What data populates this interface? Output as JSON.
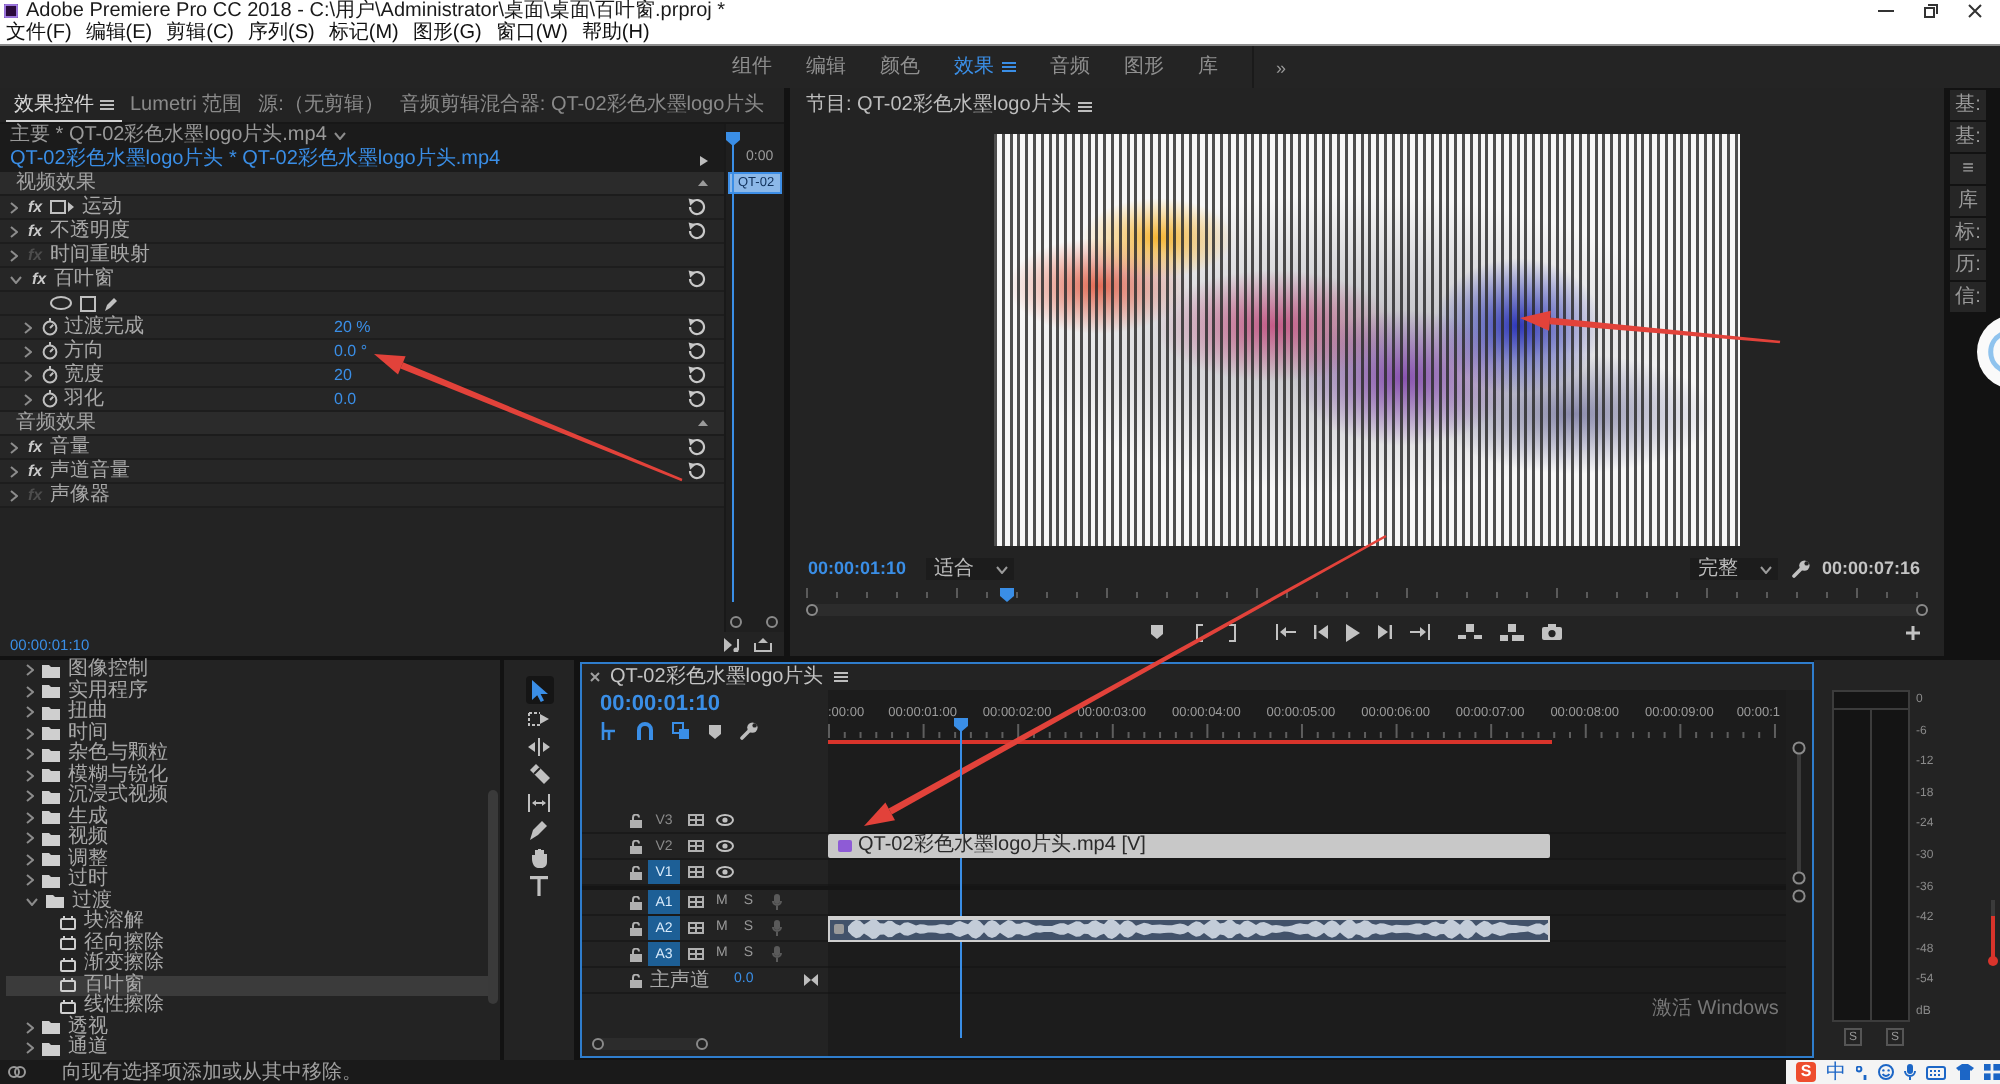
{
  "window": {
    "title": "Adobe Premiere Pro CC 2018 - C:\\用户\\Administrator\\桌面\\桌面\\百叶窗.prproj *"
  },
  "menu": [
    "文件(F)",
    "编辑(E)",
    "剪辑(C)",
    "序列(S)",
    "标记(M)",
    "图形(G)",
    "窗口(W)",
    "帮助(H)"
  ],
  "workspaces": {
    "items": [
      {
        "label": "组件",
        "selected": false
      },
      {
        "label": "编辑",
        "selected": false
      },
      {
        "label": "颜色",
        "selected": false
      },
      {
        "label": "效果",
        "selected": true
      },
      {
        "label": "音频",
        "selected": false
      },
      {
        "label": "图形",
        "selected": false
      },
      {
        "label": "库",
        "selected": false
      }
    ],
    "overflow": "»"
  },
  "effect_controls": {
    "tabs": [
      {
        "label": "效果控件",
        "selected": true
      },
      {
        "label": "Lumetri 范围",
        "selected": false
      },
      {
        "label": "源:（无剪辑）",
        "selected": false
      },
      {
        "label": "音频剪辑混合器: QT-02彩色水墨logo片头",
        "selected": false
      }
    ],
    "master_clip": "主要 * QT-02彩色水墨logo片头.mp4",
    "sequence_clip": "QT-02彩色水墨logo片头 * QT-02彩色水墨logo片头.mp4",
    "mini_timeline": {
      "time": "0:00",
      "clip": "QT-02"
    },
    "sections": [
      {
        "title": "视频效果",
        "expanded": true,
        "effects": [
          {
            "name": "运动",
            "kind": "motion",
            "badge": "fx",
            "enabled": true,
            "expanded": false,
            "resettable": true
          },
          {
            "name": "不透明度",
            "kind": "standard",
            "badge": "fx",
            "enabled": true,
            "expanded": false,
            "resettable": true
          },
          {
            "name": "时间重映射",
            "kind": "standard",
            "badge": "fx",
            "enabled": false,
            "expanded": false,
            "resettable": false
          },
          {
            "name": "百叶窗",
            "kind": "masked",
            "badge": "fx",
            "enabled": true,
            "expanded": true,
            "resettable": true,
            "parameters": [
              {
                "name": "过渡完成",
                "value": "20 %",
                "expanded": false
              },
              {
                "name": "方向",
                "value": "0.0 °",
                "expanded": false
              },
              {
                "name": "宽度",
                "value": "20",
                "expanded": false
              },
              {
                "name": "羽化",
                "value": "0.0",
                "expanded": false
              }
            ]
          }
        ]
      },
      {
        "title": "音频效果",
        "expanded": true,
        "effects": [
          {
            "name": "音量",
            "kind": "standard",
            "badge": "fx",
            "enabled": true,
            "expanded": false,
            "resettable": true
          },
          {
            "name": "声道音量",
            "kind": "standard",
            "badge": "fx",
            "enabled": true,
            "expanded": false,
            "resettable": true
          },
          {
            "name": "声像器",
            "kind": "standard",
            "badge": "fx",
            "enabled": false,
            "expanded": false,
            "resettable": false
          }
        ]
      }
    ],
    "current_time": "00:00:01:10"
  },
  "program_monitor": {
    "title": "节目: QT-02彩色水墨logo片头",
    "current_time": "00:00:01:10",
    "fit": "适合",
    "quality": "完整",
    "duration": "00:00:07:16",
    "scrubber": {
      "level": 0.18
    }
  },
  "side_panels": [
    "基:",
    "基:",
    "≡",
    "库",
    "标:",
    "历:",
    "信:"
  ],
  "effects_browser": {
    "items": [
      {
        "name": "图像控制",
        "kind": "folder",
        "expanded": false,
        "selected": false
      },
      {
        "name": "实用程序",
        "kind": "folder",
        "expanded": false,
        "selected": false
      },
      {
        "name": "扭曲",
        "kind": "folder",
        "expanded": false,
        "selected": false
      },
      {
        "name": "时间",
        "kind": "folder",
        "expanded": false,
        "selected": false
      },
      {
        "name": "杂色与颗粒",
        "kind": "folder",
        "expanded": false,
        "selected": false
      },
      {
        "name": "模糊与锐化",
        "kind": "folder",
        "expanded": false,
        "selected": false
      },
      {
        "name": "沉浸式视频",
        "kind": "folder",
        "expanded": false,
        "selected": false
      },
      {
        "name": "生成",
        "kind": "folder",
        "expanded": false,
        "selected": false
      },
      {
        "name": "视频",
        "kind": "folder",
        "expanded": false,
        "selected": false
      },
      {
        "name": "调整",
        "kind": "folder",
        "expanded": false,
        "selected": false
      },
      {
        "name": "过时",
        "kind": "folder",
        "expanded": false,
        "selected": false
      },
      {
        "name": "过渡",
        "kind": "folder",
        "expanded": true,
        "selected": false,
        "children": [
          {
            "name": "块溶解",
            "kind": "effect",
            "selected": false
          },
          {
            "name": "径向擦除",
            "kind": "effect",
            "selected": false
          },
          {
            "name": "渐变擦除",
            "kind": "effect",
            "selected": false
          },
          {
            "name": "百叶窗",
            "kind": "effect",
            "selected": true
          },
          {
            "name": "线性擦除",
            "kind": "effect",
            "selected": false
          }
        ]
      },
      {
        "name": "透视",
        "kind": "folder",
        "expanded": false,
        "selected": false
      },
      {
        "name": "通道",
        "kind": "folder",
        "expanded": false,
        "selected": false
      }
    ]
  },
  "tools": [
    {
      "kind": "selection",
      "selected": true
    },
    {
      "kind": "track_select",
      "selected": false
    },
    {
      "kind": "ripple_edit",
      "selected": false
    },
    {
      "kind": "razor",
      "selected": false
    },
    {
      "kind": "slip",
      "selected": false
    },
    {
      "kind": "pen",
      "selected": false
    },
    {
      "kind": "hand",
      "selected": false
    },
    {
      "kind": "type",
      "selected": false
    }
  ],
  "timeline": {
    "title": "QT-02彩色水墨logo片头",
    "current_time": "00:00:01:10",
    "ruler": [
      ":00:00",
      "00:00:01:00",
      "00:00:02:00",
      "00:00:03:00",
      "00:00:04:00",
      "00:00:05:00",
      "00:00:06:00",
      "00:00:07:00",
      "00:00:08:00",
      "00:00:09:00",
      "00:00:1"
    ],
    "work_area": {
      "level": 0.756
    },
    "playhead": {
      "level": 0.138
    },
    "tracks": [
      {
        "name": "V3",
        "kind": "video",
        "targeted": false
      },
      {
        "name": "V2",
        "kind": "video",
        "targeted": false,
        "clip": {
          "kind": "video",
          "label": "QT-02彩色水墨logo片头.mp4 [V]"
        }
      },
      {
        "name": "V1",
        "kind": "video",
        "targeted": true
      },
      {
        "name": "A1",
        "kind": "audio",
        "targeted": true,
        "mute": "M",
        "solo": "S"
      },
      {
        "name": "A2",
        "kind": "audio",
        "targeted": true,
        "mute": "M",
        "solo": "S",
        "clip": {
          "kind": "audio"
        }
      },
      {
        "name": "A3",
        "kind": "audio",
        "targeted": true,
        "mute": "M",
        "solo": "S"
      }
    ],
    "master": {
      "name": "主声道",
      "value": "0.0"
    }
  },
  "audio_meter": {
    "scale": [
      "0",
      "-6",
      "-12",
      "-18",
      "-24",
      "-30",
      "-36",
      "-42",
      "-48",
      "-54",
      "dB"
    ],
    "solo": [
      "S",
      "S"
    ]
  },
  "status_bar": {
    "text": "向现有选择项添加或从其中移除。"
  },
  "ime_toolbar": {
    "logo": "S",
    "language": "中"
  },
  "os_notice": "激活 Windows"
}
